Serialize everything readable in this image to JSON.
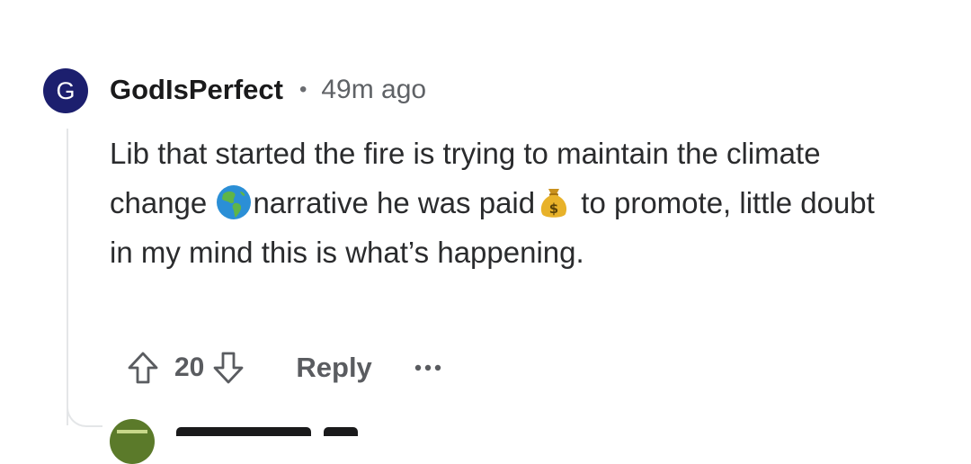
{
  "comment": {
    "avatar_letter": "G",
    "avatar_color": "#1c1f6e",
    "username": "GodIsPerfect",
    "separator": "•",
    "timestamp": "49m ago",
    "body": {
      "part1": "Lib that started the fire is trying to maintain the climate change ",
      "emoji1": "globe-americas-icon",
      "part2": "narrative he was paid",
      "emoji2": "money-bag-icon",
      "part3": " to promote, little doubt in my mind this is what’s happening."
    },
    "score": "20",
    "reply_label": "Reply",
    "more_icon": "more-dots-icon"
  },
  "next_comment": {
    "avatar_color": "#5b7a2a"
  }
}
